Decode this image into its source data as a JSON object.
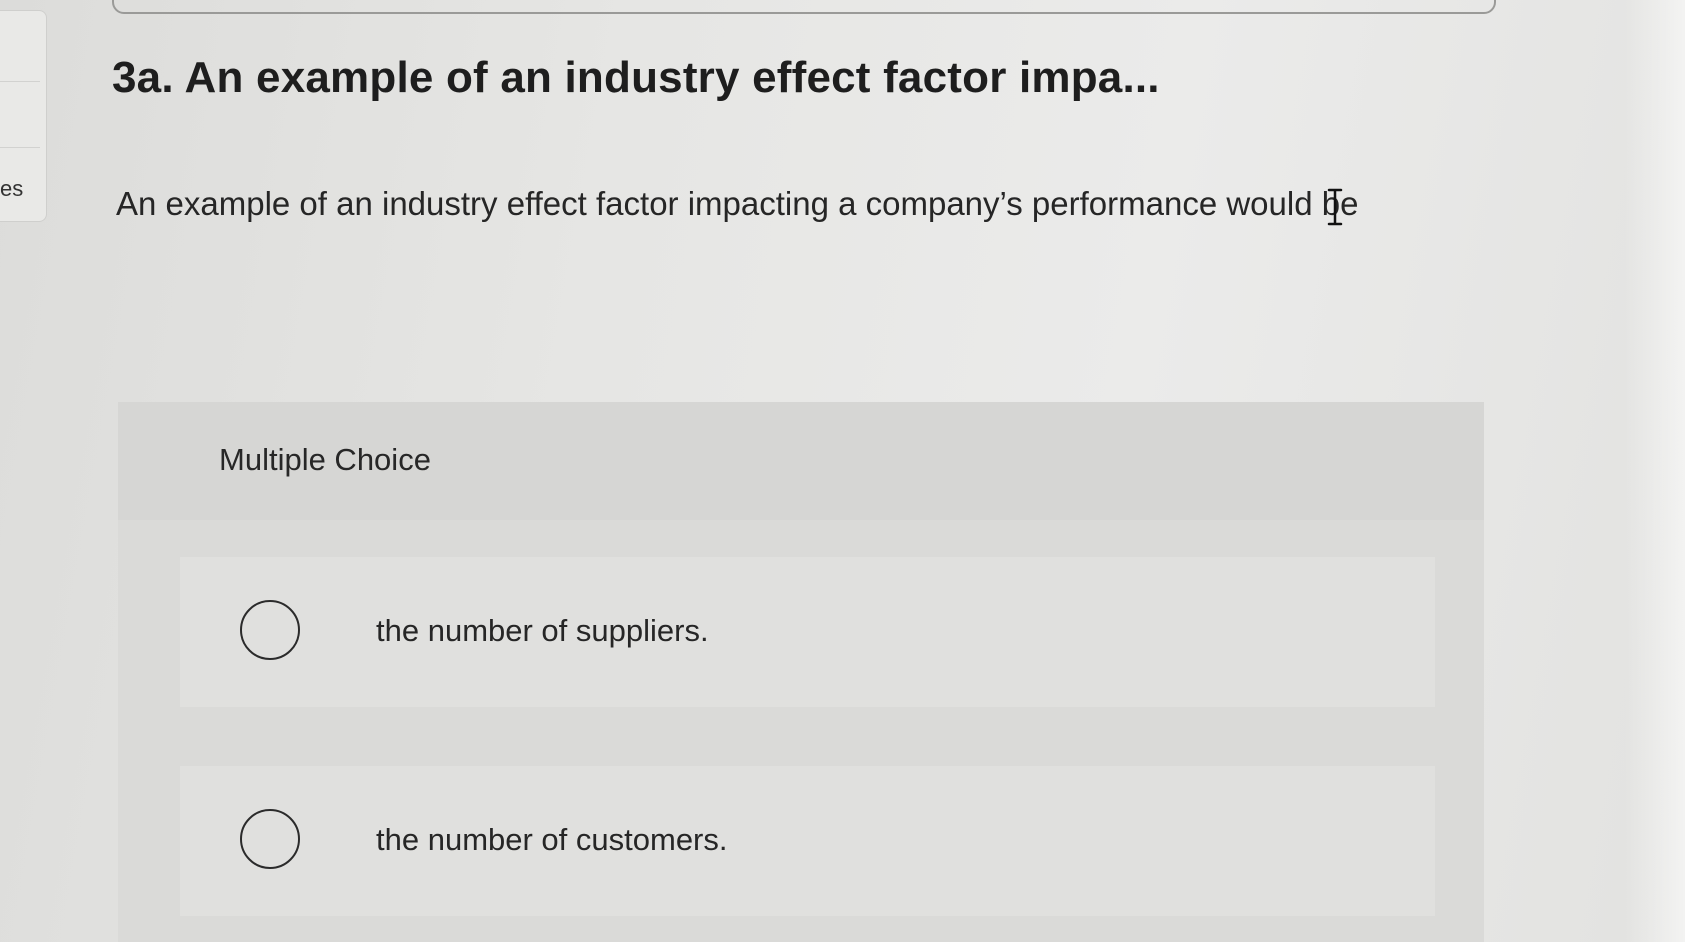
{
  "sidebar": {
    "label_fragment": "es"
  },
  "question": {
    "title": "3a. An example of an industry effect factor impa...",
    "prompt": "An example of an industry effect factor impacting a company’s performance would be"
  },
  "multiple_choice": {
    "header_label": "Multiple Choice",
    "options": [
      {
        "label": "the number of suppliers.",
        "selected": false
      },
      {
        "label": "the number of customers.",
        "selected": false
      }
    ]
  },
  "icons": {
    "cursor": "text-cursor-icon",
    "radio": "radio-button-icon"
  },
  "colors": {
    "background": "#e3e3e1",
    "card": "#dadad8",
    "option_row": "#e0e0de",
    "text": "#1f1f1f"
  }
}
